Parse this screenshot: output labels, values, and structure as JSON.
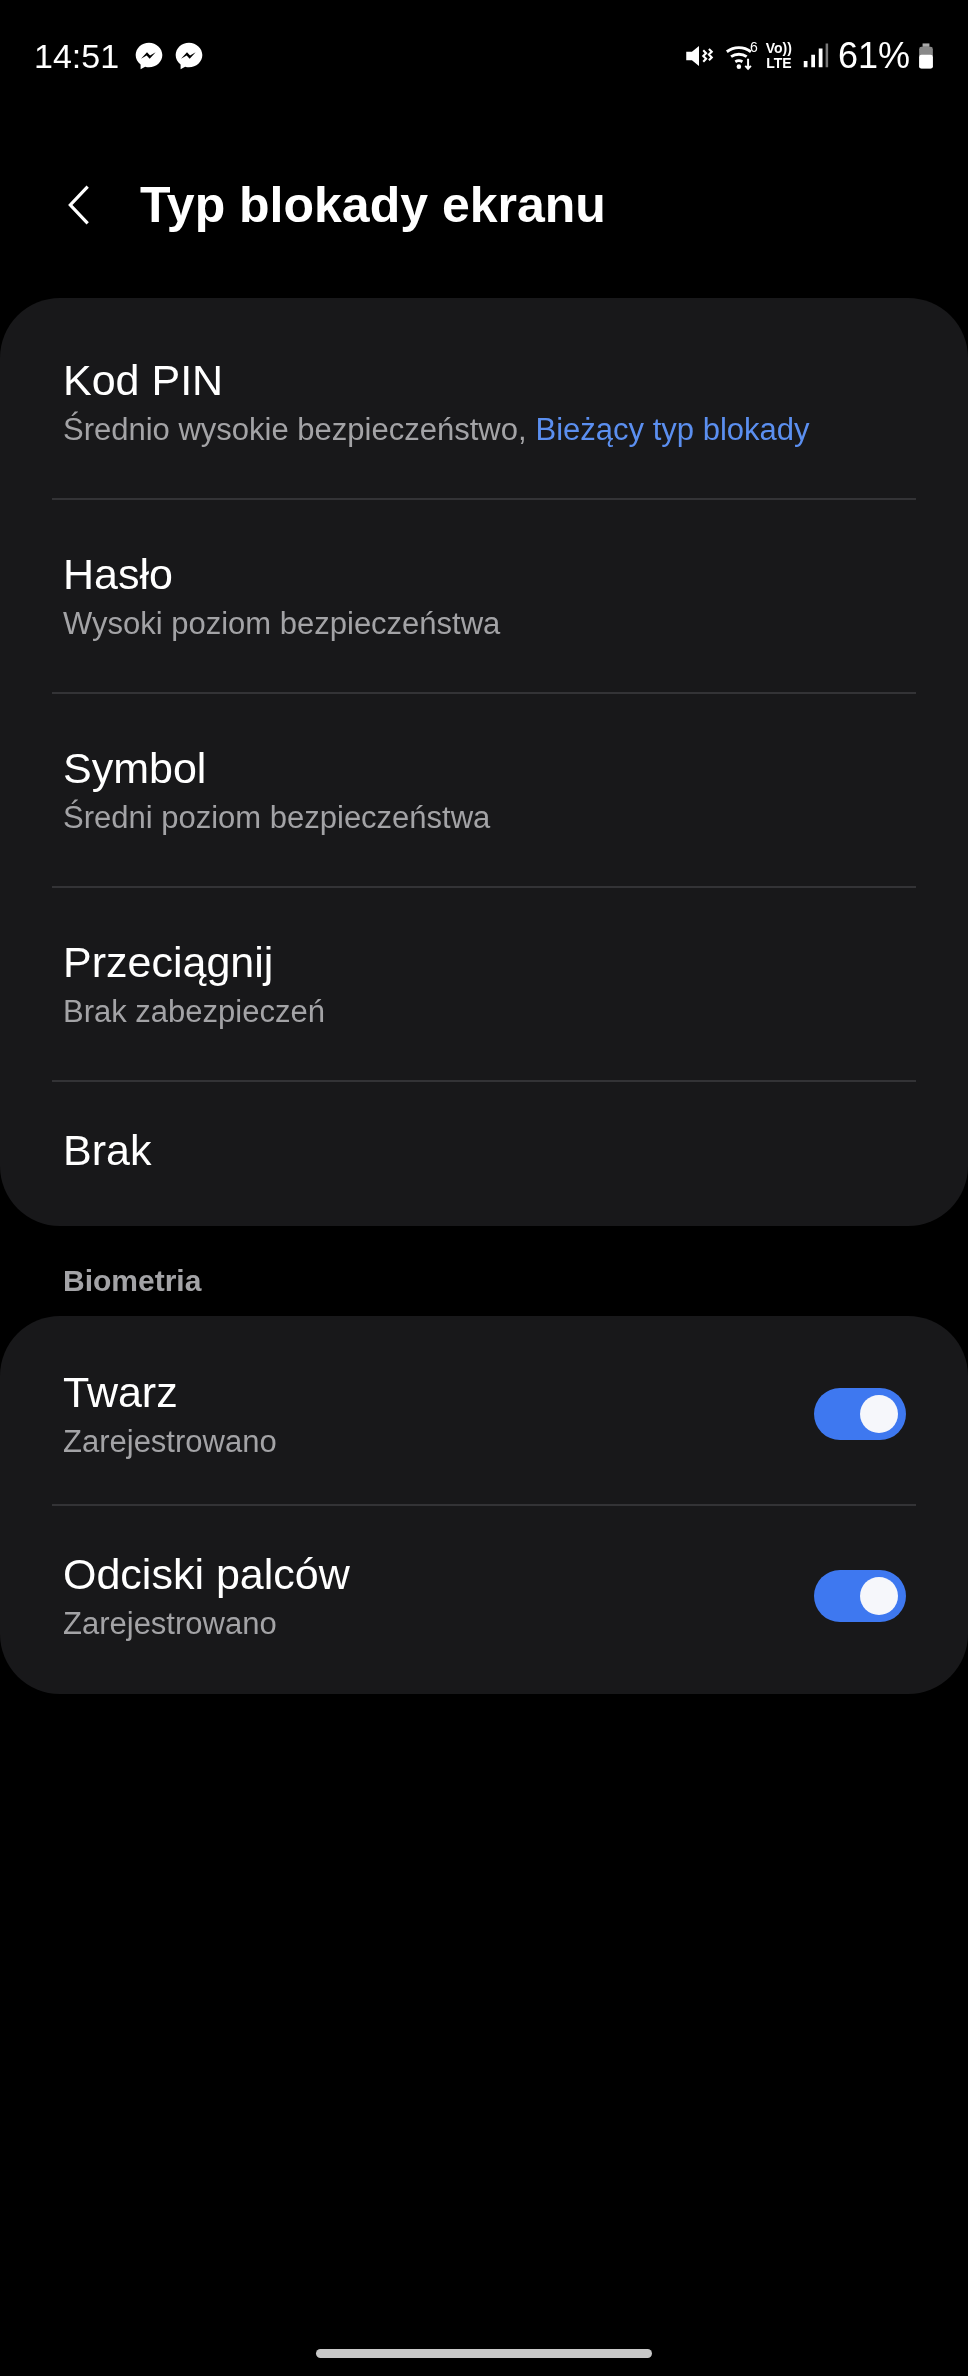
{
  "status_bar": {
    "time": "14:51",
    "wifi_badge": "6",
    "volte": [
      "Vo))",
      "LTE"
    ],
    "battery": "61%"
  },
  "header": {
    "title": "Typ blokady ekranu"
  },
  "lock_types": [
    {
      "title": "Kod PIN",
      "subtitle": "Średnio wysokie bezpieczeństwo,",
      "current": "Bieżący typ blokady"
    },
    {
      "title": "Hasło",
      "subtitle": "Wysoki poziom bezpieczeństwa"
    },
    {
      "title": "Symbol",
      "subtitle": "Średni poziom bezpieczeństwa"
    },
    {
      "title": "Przeciągnij",
      "subtitle": "Brak zabezpieczeń"
    },
    {
      "title": "Brak"
    }
  ],
  "biometrics": {
    "heading": "Biometria",
    "items": [
      {
        "title": "Twarz",
        "subtitle": "Zarejestrowano",
        "on": true
      },
      {
        "title": "Odciski palców",
        "subtitle": "Zarejestrowano",
        "on": true
      }
    ]
  }
}
